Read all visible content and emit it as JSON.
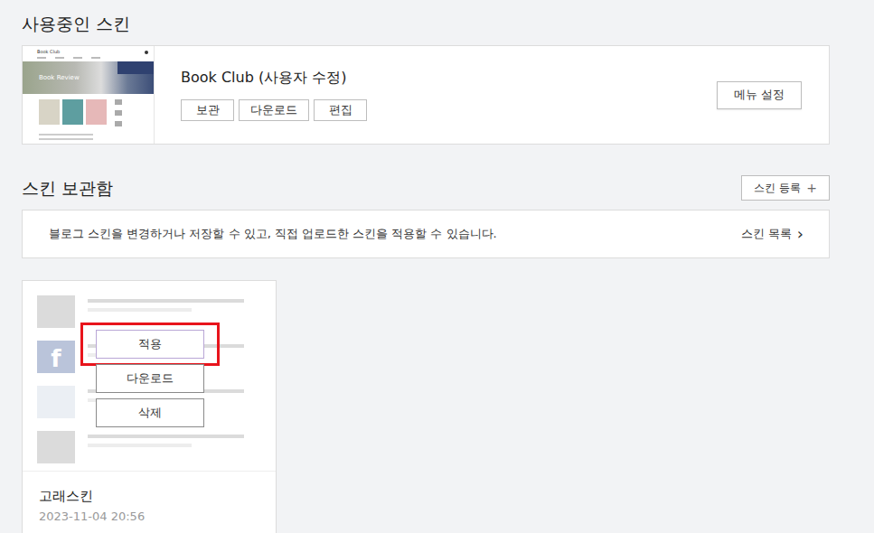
{
  "current": {
    "heading": "사용중인 스킨",
    "skin": {
      "title": "Book Club (사용자 수정)",
      "thumbnail": {
        "brand": "Book Club",
        "banner": "Book Review"
      },
      "actions": [
        "보관",
        "다운로드",
        "편집"
      ]
    },
    "menu_button": "메뉴 설정"
  },
  "archive": {
    "heading": "스킨 보관함",
    "register_button": {
      "label": "스킨 등록",
      "icon": "+"
    },
    "info": {
      "text": "블로그 스킨을 변경하거나 저장할 수 있고, 직접 업로드한 스킨을 적용할 수 있습니다.",
      "link": "스킨 목록",
      "link_icon": "›"
    },
    "skins": [
      {
        "name": "고래스킨",
        "date": "2023-11-04 20:56",
        "preview_icon": "f",
        "actions": [
          {
            "label": "적용",
            "highlighted": true
          },
          {
            "label": "다운로드",
            "highlighted": false
          },
          {
            "label": "삭제",
            "highlighted": false
          }
        ]
      }
    ]
  }
}
